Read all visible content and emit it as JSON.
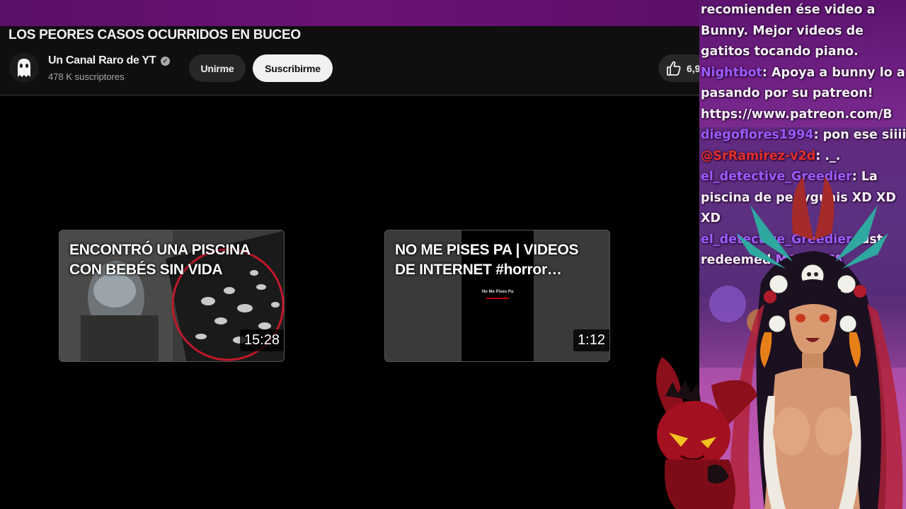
{
  "video": {
    "title": "LOS PEORES CASOS OCURRIDOS EN BUCEO",
    "channel": {
      "name": "Un Canal Raro de YT",
      "subscribers": "478 K suscriptores"
    },
    "join_label": "Unirme",
    "subscribe_label": "Suscribirme",
    "like_count": "6,9"
  },
  "end_screen": {
    "cards": [
      {
        "title": "ENCONTRÓ UNA PISCINA CON BEBÉS SIN VIDA",
        "duration": "15:28"
      },
      {
        "title": "NO ME PISES PA | VIDEOS DE INTERNET #horror…",
        "duration": "1:12",
        "inner_text": "No Me Pises Pa"
      }
    ]
  },
  "chat": {
    "messages": [
      {
        "user": "",
        "text": "recomienden ése video a"
      },
      {
        "user": "",
        "text": "Bunny. Mejor videos de"
      },
      {
        "user": "",
        "text": "gatitos tocando piano."
      },
      {
        "user": "Nightbot",
        "text": ": Apoya a bunny lo a"
      },
      {
        "user": "",
        "text": "pasando por su patreon!"
      },
      {
        "user": "",
        "text": "https://www.patreon.com/B"
      },
      {
        "user": "diegoflores1994",
        "text": ": pon ese siiii"
      },
      {
        "user": "@SrRamirez-v2d",
        "text": ": ._."
      },
      {
        "user": "el_detective_Greedier",
        "text": ": La"
      },
      {
        "user": "",
        "text": "piscina de penyguais XD XD"
      },
      {
        "user": "",
        "text": "XD"
      },
      {
        "user": "el_detective_Greedier",
        "text": " just"
      },
      {
        "user": "",
        "text": "redeemed",
        "highlight": "MASCOTA"
      }
    ]
  },
  "colors": {
    "top_band": "#5a1066",
    "chat_user_purple": "#9a5cff",
    "chat_user_red": "#e0302a",
    "subscribe_bg": "#f1f1f1"
  }
}
